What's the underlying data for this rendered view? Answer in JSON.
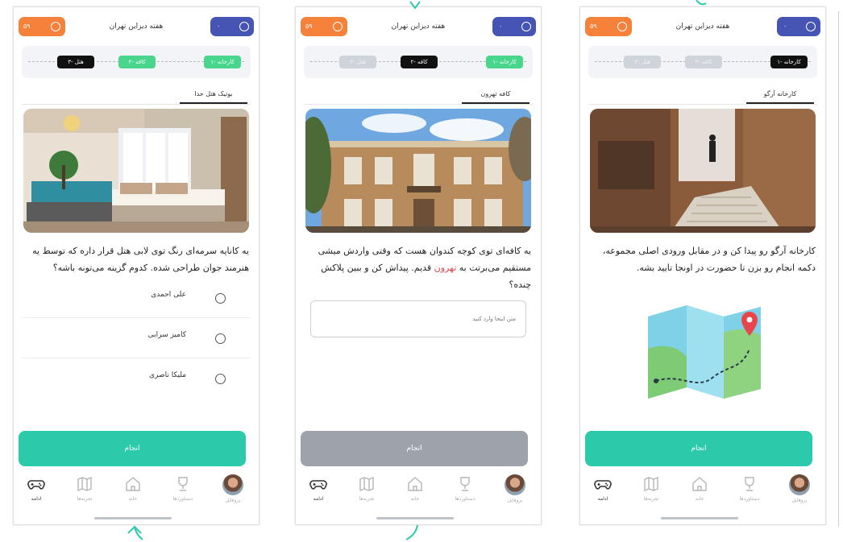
{
  "common": {
    "app_title": "هفته دیزاین تهران",
    "score": "۵۹",
    "top_right_value": "۰",
    "steps": [
      "۱- کارخانه",
      "۲- کافه",
      "۳- هتل"
    ],
    "nav": [
      "ادامه",
      "تجربه‌ها",
      "خانه",
      "دستاوردها",
      "پروفایل"
    ],
    "cta_label": "انجام"
  },
  "screen1": {
    "subtab": "بوتیک هتل حدا",
    "question": "یه کاناپه سرمه‌ای رنگ توی لابی هتل قرار داره که توسط یه هنرمند جوان طراحی شده. کدوم گزینه می‌تونه باشه؟",
    "options": [
      "علی احمدی",
      "کامیز سرابی",
      "ملیکا ناصری"
    ]
  },
  "screen2": {
    "subtab": "کافه تهرون",
    "question_a": "یه کافه‌ای توی کوچه کندوان هست که وقتی واردش میشی مستقیم می‌برتت به ",
    "question_highlight": "تهرون",
    "question_b": " قدیم. پیداش کن و ببین پلاکش چنده؟",
    "input_placeholder": "متن اینجا وارد کنید"
  },
  "screen3": {
    "subtab": "کارخانه آرگو",
    "question": "کارخانه آرگو رو پیدا کن و در مقابل ورودی اصلی مجموعه، دکمه انجام رو بزن تا حضورت در اونجا تایید بشه."
  },
  "colors": {
    "teal": "#2bcaaa",
    "orange": "#f5813a",
    "indigo": "#4655b4",
    "green": "#47d68b",
    "disabled": "#9ea2aa",
    "highlight": "#e0484d"
  }
}
